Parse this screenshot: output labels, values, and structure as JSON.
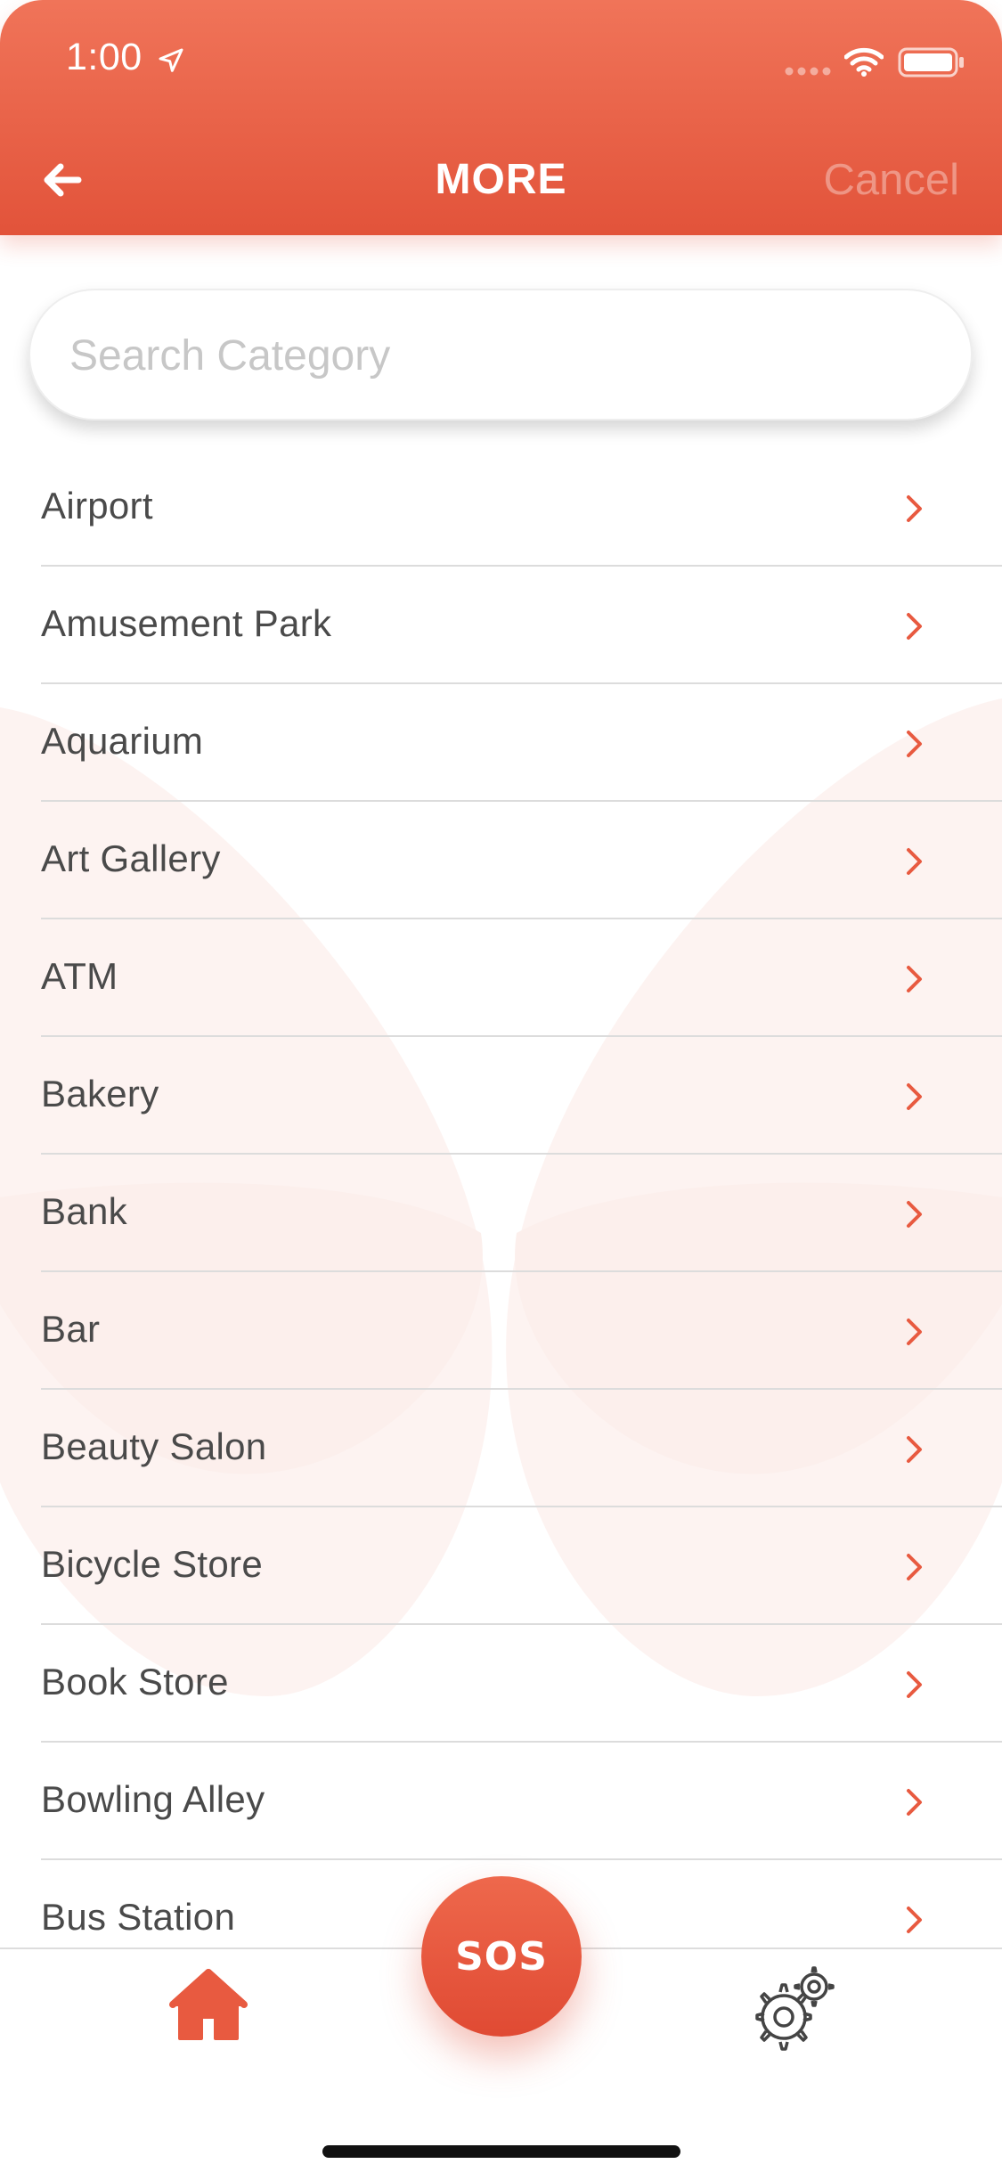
{
  "status_bar": {
    "time": "1:00",
    "icons": [
      "location-arrow-icon",
      "cellular-signal-icon",
      "wifi-icon",
      "battery-icon"
    ]
  },
  "header": {
    "title": "MORE",
    "back_icon": "arrow-left-icon",
    "cancel_label": "Cancel"
  },
  "search": {
    "placeholder": "Search Category",
    "value": ""
  },
  "categories": [
    "Airport",
    "Amusement Park",
    "Aquarium",
    "Art Gallery",
    "ATM",
    "Bakery",
    "Bank",
    "Bar",
    "Beauty Salon",
    "Bicycle Store",
    "Book Store",
    "Bowling Alley",
    "Bus Station"
  ],
  "row_icon": "chevron-right-icon",
  "tab_bar": {
    "home_icon": "home-icon",
    "sos_label": "SOS",
    "settings_icon": "gear-icon"
  },
  "colors": {
    "accent": "#e85a40",
    "accent_light": "#f07459",
    "text": "#4a4a4a",
    "divider": "#dcdcdc",
    "placeholder": "#c7c7c7"
  }
}
